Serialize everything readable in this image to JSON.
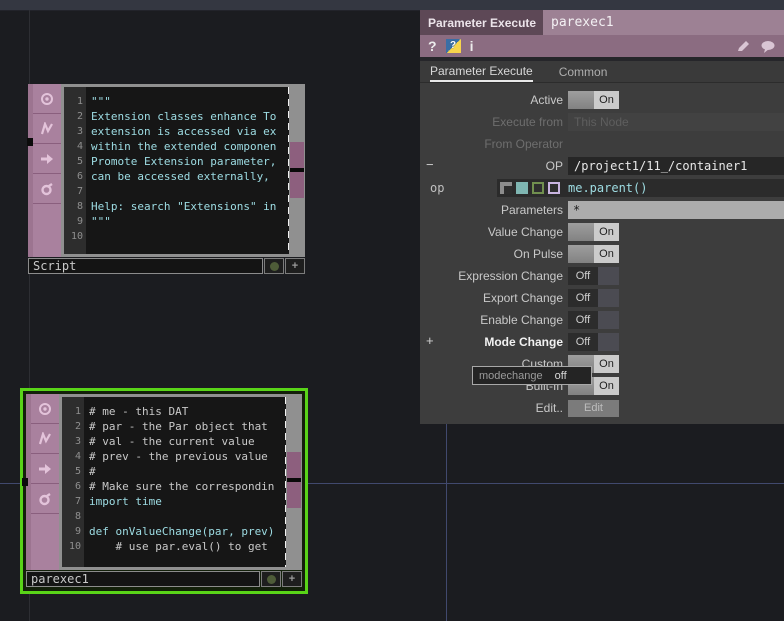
{
  "colors": {
    "accent_purple": "#8b6c81",
    "select_green": "#59d418",
    "grid_blue": "#41496e",
    "expr_cyan": "#9edce2"
  },
  "dialog": {
    "title": "Parameter Execute",
    "node_name": "parexec1",
    "icons": {
      "help": "?",
      "python_help": "?",
      "info": "i"
    },
    "tabs": [
      {
        "label": "Parameter Execute",
        "active": true
      },
      {
        "label": "Common",
        "active": false
      }
    ],
    "rows": [
      {
        "label": "Active",
        "type": "toggle",
        "value": "On"
      },
      {
        "label": "Execute from",
        "type": "menu",
        "value": "This Node",
        "disabled": true
      },
      {
        "label": "From Operator",
        "type": "label-only",
        "disabled": true
      },
      {
        "label": "OP",
        "type": "text",
        "value": "/project1/11_/container1",
        "prefix": "−"
      },
      {
        "label": "op",
        "type": "expr",
        "value": "me.parent()"
      },
      {
        "label": "Parameters",
        "type": "input",
        "value": "*"
      },
      {
        "label": "Value Change",
        "type": "toggle",
        "value": "On"
      },
      {
        "label": "On Pulse",
        "type": "toggle",
        "value": "On"
      },
      {
        "label": "Expression Change",
        "type": "toggle",
        "value": "Off"
      },
      {
        "label": "Export Change",
        "type": "toggle",
        "value": "Off"
      },
      {
        "label": "Enable Change",
        "type": "toggle",
        "value": "Off"
      },
      {
        "label": "Mode Change",
        "type": "toggle",
        "value": "Off",
        "prefix": "+",
        "hover": true
      },
      {
        "label": "Custom",
        "type": "toggle",
        "value": "On"
      },
      {
        "label": "Built-In",
        "type": "toggle",
        "value": "On"
      },
      {
        "label": "Edit..",
        "type": "button",
        "value": "Edit"
      }
    ],
    "tooltip": {
      "param": "modechange",
      "value": "off"
    }
  },
  "nodes": [
    {
      "name": "Script",
      "selected": false,
      "code": [
        {
          "n": "1",
          "t": "\"\"\"",
          "c": "str"
        },
        {
          "n": "2",
          "t": "Extension classes enhance To",
          "c": "str"
        },
        {
          "n": "3",
          "t": "extension is accessed via ex",
          "c": "str"
        },
        {
          "n": "4",
          "t": "within the extended componen",
          "c": "str"
        },
        {
          "n": "5",
          "t": "Promote Extension parameter,",
          "c": "str"
        },
        {
          "n": "6",
          "t": "can be accessed externally,",
          "c": "str"
        },
        {
          "n": "7",
          "t": "",
          "c": "str"
        },
        {
          "n": "8",
          "t": "Help: search \"Extensions\" in",
          "c": "str"
        },
        {
          "n": "9",
          "t": "\"\"\"",
          "c": "str"
        },
        {
          "n": "10",
          "t": "",
          "c": "str"
        }
      ]
    },
    {
      "name": "parexec1",
      "selected": true,
      "code": [
        {
          "n": "1",
          "t": "# me - this DAT",
          "c": "com"
        },
        {
          "n": "2",
          "t": "# par - the Par object that",
          "c": "com"
        },
        {
          "n": "3",
          "t": "# val - the current value",
          "c": "com"
        },
        {
          "n": "4",
          "t": "# prev - the previous value",
          "c": "com"
        },
        {
          "n": "5",
          "t": "#",
          "c": "com"
        },
        {
          "n": "6",
          "t": "# Make sure the correspondin",
          "c": "com"
        },
        {
          "n": "7",
          "t": "import time",
          "c": "kw"
        },
        {
          "n": "8",
          "t": "",
          "c": "com"
        },
        {
          "n": "9",
          "t": "def onValueChange(par, prev)",
          "c": "kw"
        },
        {
          "n": "10",
          "t": "    # use par.eval() to get",
          "c": "com"
        }
      ]
    }
  ]
}
